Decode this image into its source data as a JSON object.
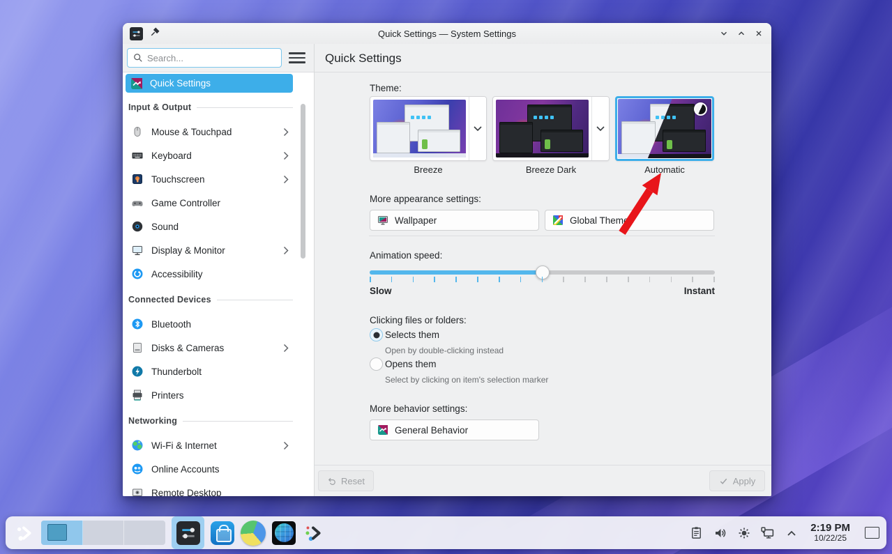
{
  "titlebar": {
    "title": "Quick Settings — System Settings"
  },
  "sidebar": {
    "search_placeholder": "Search...",
    "selected": {
      "label": "Quick Settings"
    },
    "sections": [
      {
        "label": "Input & Output",
        "items": [
          {
            "label": "Mouse & Touchpad",
            "has_submenu": true
          },
          {
            "label": "Keyboard",
            "has_submenu": true
          },
          {
            "label": "Touchscreen",
            "has_submenu": true
          },
          {
            "label": "Game Controller",
            "has_submenu": false
          },
          {
            "label": "Sound",
            "has_submenu": false
          },
          {
            "label": "Display & Monitor",
            "has_submenu": true
          },
          {
            "label": "Accessibility",
            "has_submenu": false
          }
        ]
      },
      {
        "label": "Connected Devices",
        "items": [
          {
            "label": "Bluetooth",
            "has_submenu": false
          },
          {
            "label": "Disks & Cameras",
            "has_submenu": true
          },
          {
            "label": "Thunderbolt",
            "has_submenu": false
          },
          {
            "label": "Printers",
            "has_submenu": false
          }
        ]
      },
      {
        "label": "Networking",
        "items": [
          {
            "label": "Wi-Fi & Internet",
            "has_submenu": true
          },
          {
            "label": "Online Accounts",
            "has_submenu": false
          },
          {
            "label": "Remote Desktop",
            "has_submenu": false
          }
        ]
      }
    ]
  },
  "content": {
    "page_title": "Quick Settings",
    "theme": {
      "label": "Theme:",
      "options": [
        {
          "name": "Breeze",
          "selected": false
        },
        {
          "name": "Breeze Dark",
          "selected": false
        },
        {
          "name": "Automatic",
          "selected": true
        }
      ]
    },
    "appearance": {
      "label": "More appearance settings:",
      "wallpaper_button": "Wallpaper",
      "global_theme_button": "Global Theme"
    },
    "animation": {
      "label": "Animation speed:",
      "slow_label": "Slow",
      "instant_label": "Instant",
      "value_percent": 50
    },
    "clicking": {
      "label": "Clicking files or folders:",
      "options": [
        {
          "label": "Selects them",
          "description": "Open by double-clicking instead",
          "selected": true
        },
        {
          "label": "Opens them",
          "description": "Select by clicking on item's selection marker",
          "selected": false
        }
      ]
    },
    "behavior": {
      "label": "More behavior settings:",
      "general_behavior_button": "General Behavior"
    }
  },
  "footer": {
    "reset_label": "Reset",
    "apply_label": "Apply"
  },
  "taskbar": {
    "clock_time": "2:19 PM",
    "clock_date": "10/22/25",
    "virtual_desktops": 3,
    "active_desktop": 1
  },
  "colors": {
    "accent": "#3daee9",
    "arrow_red": "#e8151a",
    "window_bg": "#eff0f1",
    "sidebar_bg": "#ffffff"
  }
}
